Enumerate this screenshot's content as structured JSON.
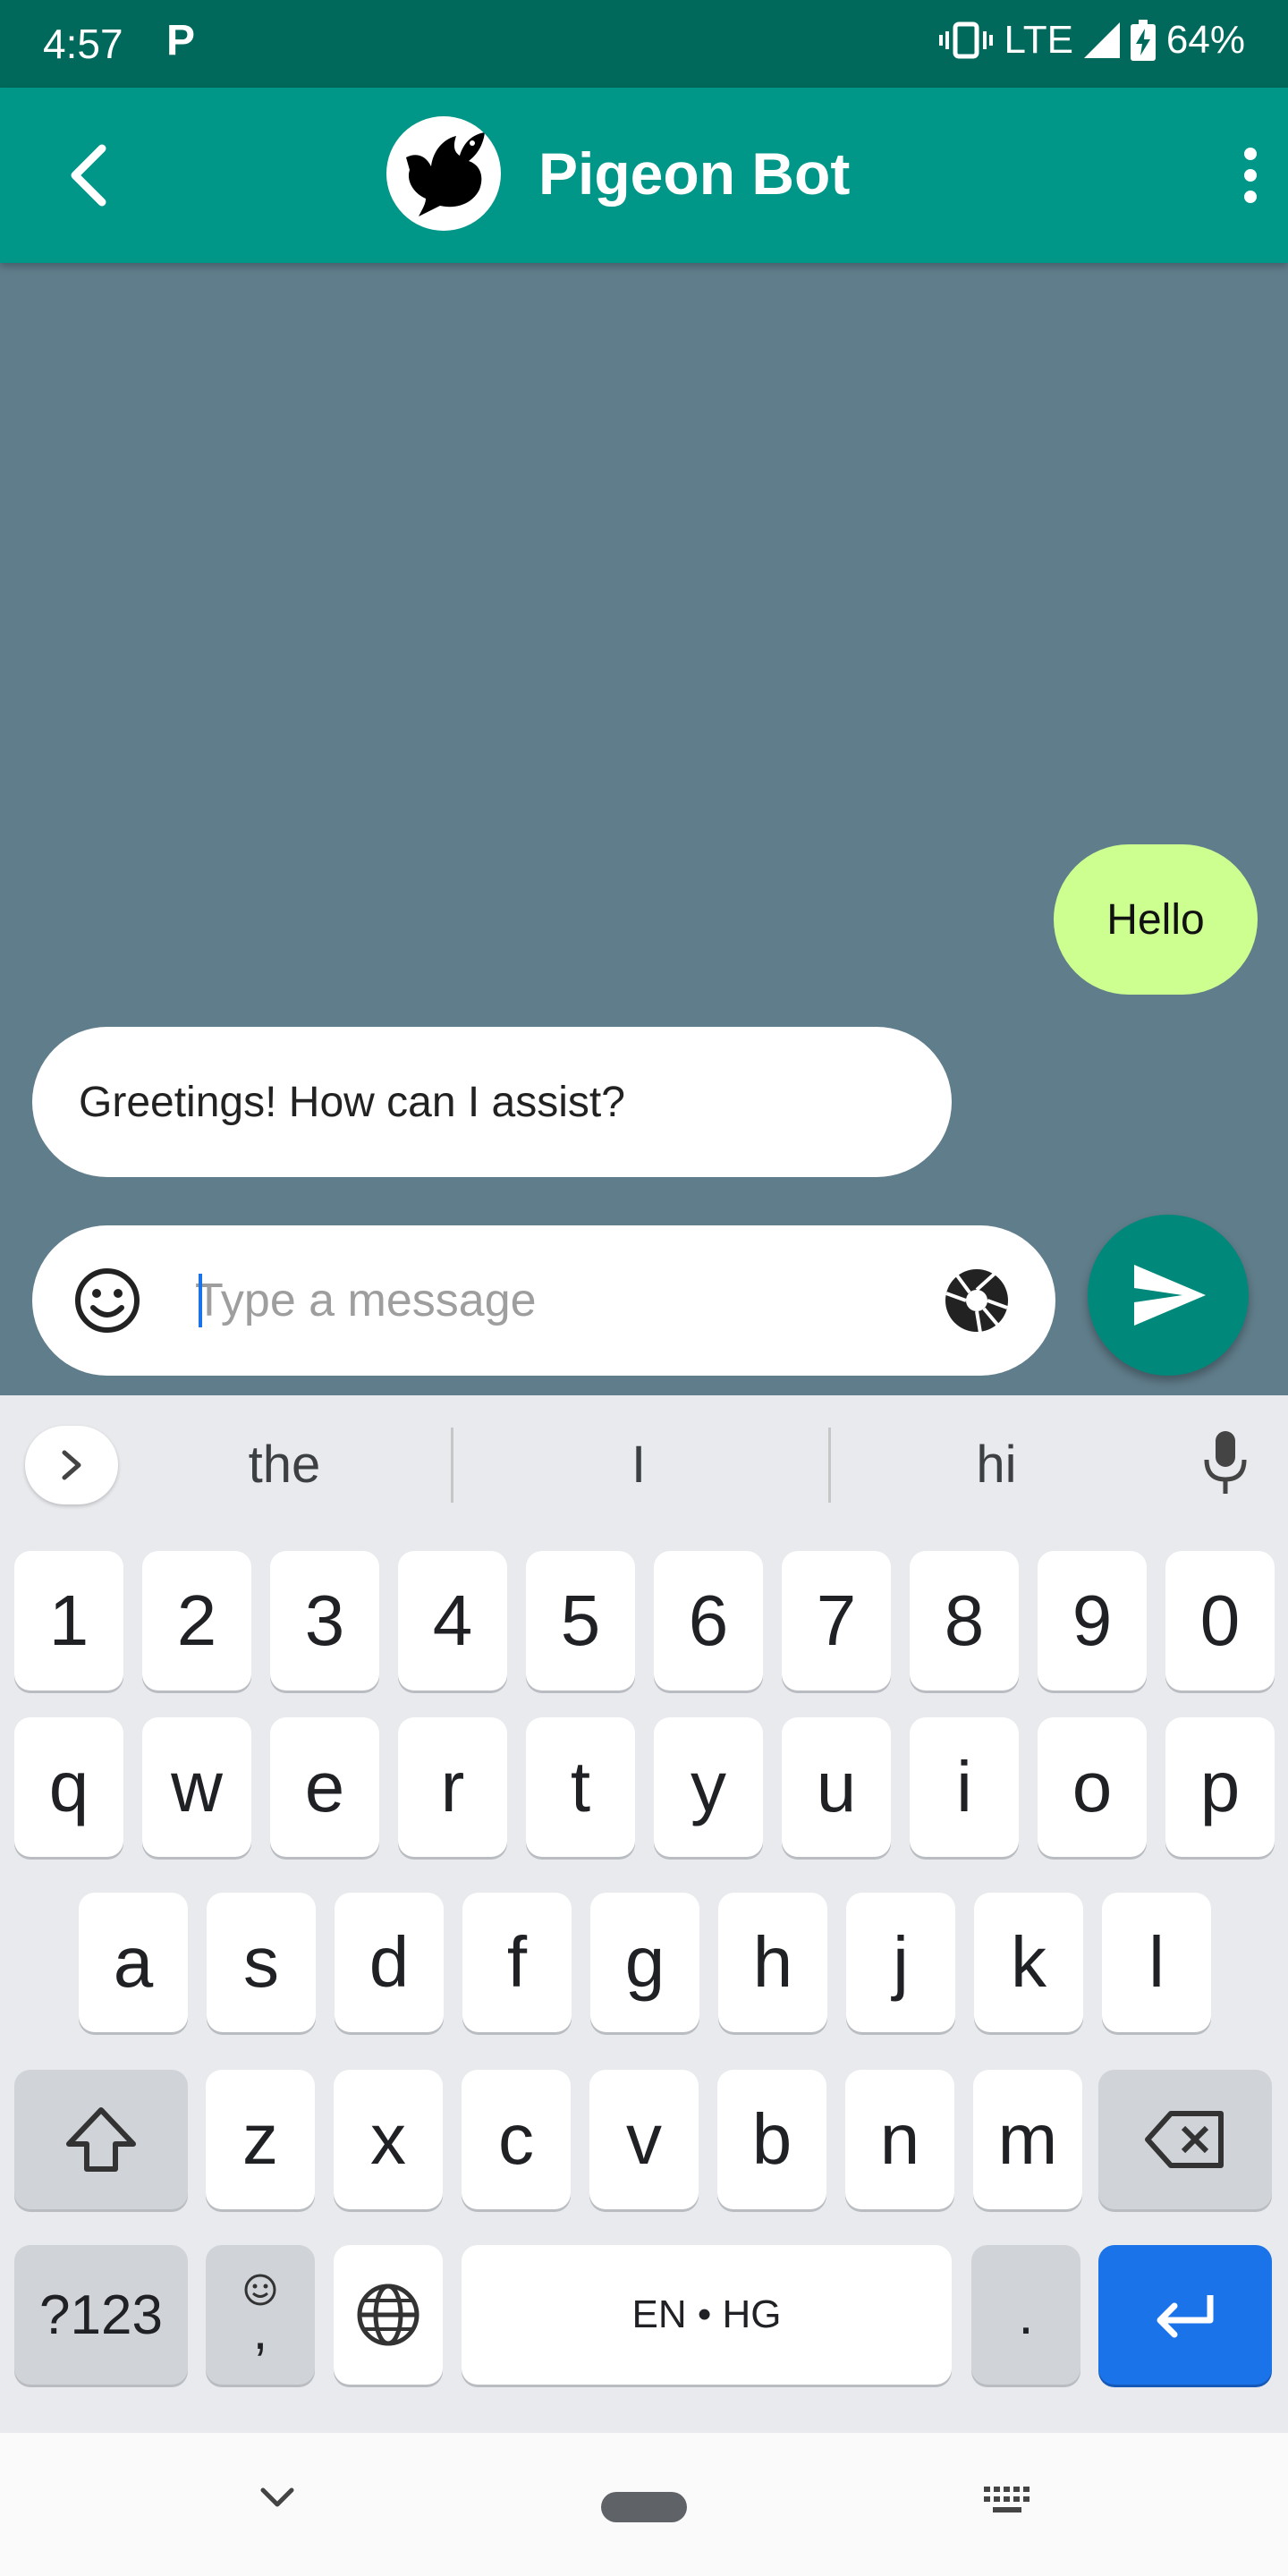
{
  "status_bar": {
    "time": "4:57",
    "app_indicator": "P",
    "network": "LTE",
    "battery": "64%"
  },
  "app_bar": {
    "title": "Pigeon Bot",
    "back_icon": "chevron-left-icon",
    "menu_icon": "more-vert-icon"
  },
  "messages": [
    {
      "direction": "outgoing",
      "text": "Hello"
    },
    {
      "direction": "incoming",
      "text": "Greetings! How can I assist?"
    }
  ],
  "composer": {
    "placeholder": "Type a message",
    "value": ""
  },
  "keyboard": {
    "suggestions": [
      "the",
      "I",
      "hi"
    ],
    "number_row": [
      "1",
      "2",
      "3",
      "4",
      "5",
      "6",
      "7",
      "8",
      "9",
      "0"
    ],
    "row1": [
      "q",
      "w",
      "e",
      "r",
      "t",
      "y",
      "u",
      "i",
      "o",
      "p"
    ],
    "row2": [
      "a",
      "s",
      "d",
      "f",
      "g",
      "h",
      "j",
      "k",
      "l"
    ],
    "row3": [
      "z",
      "x",
      "c",
      "v",
      "b",
      "n",
      "m"
    ],
    "symbols_key": "?123",
    "comma_key": ",",
    "space_label": "EN • HG",
    "period_key": "."
  },
  "colors": {
    "status_bar": "#00695c",
    "app_bar": "#009688",
    "chat_background": "#607d8b",
    "outgoing_bubble": "#ccff90",
    "incoming_bubble": "#ffffff",
    "send_button": "#00897b",
    "enter_key": "#1a73e8"
  }
}
